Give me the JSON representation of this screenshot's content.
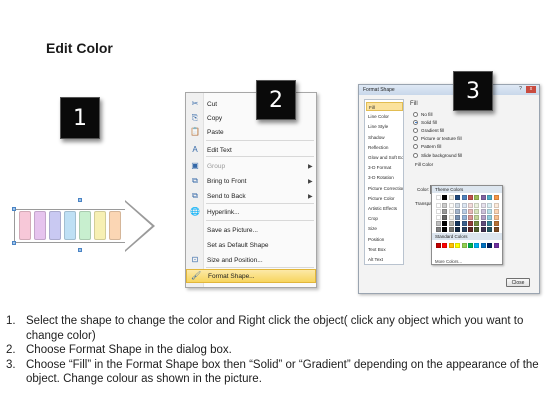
{
  "title": "Edit Color",
  "steps": [
    {
      "num": "1.",
      "text": "Select the shape to change the color and Right click the object( click any object which you want to change color)"
    },
    {
      "num": "2.",
      "text": "Choose Format Shape in the dialog box."
    },
    {
      "num": "3.",
      "text": "Choose “Fill” in the Format Shape box then “Solid” or “Gradient” depending on the appearance of the object. Change colour as shown in the picture."
    }
  ],
  "badges": [
    "1",
    "2",
    "3"
  ],
  "shape": {
    "segment_colors": [
      "#f7c8d8",
      "#e6c4ee",
      "#c9c9f2",
      "#bfe0f5",
      "#c8efcf",
      "#f7f0b4",
      "#fbd6b4"
    ]
  },
  "context_menu": {
    "items": [
      {
        "label": "Cut",
        "icon": "scissors-icon",
        "glyph": "✂"
      },
      {
        "label": "Copy",
        "icon": "copy-icon",
        "glyph": "⎘"
      },
      {
        "label": "Paste",
        "icon": "paste-icon",
        "glyph": "📋"
      },
      {
        "label": "Edit Text",
        "icon": "edit-text-icon",
        "glyph": "A"
      },
      {
        "label": "Group",
        "icon": "group-icon",
        "glyph": "▣",
        "disabled": true,
        "submenu": true
      },
      {
        "label": "Bring to Front",
        "icon": "bring-to-front-icon",
        "glyph": "⧉",
        "submenu": true
      },
      {
        "label": "Send to Back",
        "icon": "send-to-back-icon",
        "glyph": "⧉",
        "submenu": true
      },
      {
        "label": "Hyperlink...",
        "icon": "hyperlink-icon",
        "glyph": "🌐"
      },
      {
        "label": "Save as Picture...",
        "icon": "",
        "glyph": ""
      },
      {
        "label": "Set as Default Shape",
        "icon": "",
        "glyph": ""
      },
      {
        "label": "Size and Position...",
        "icon": "size-position-icon",
        "glyph": "⊡"
      },
      {
        "label": "Format Shape...",
        "icon": "format-shape-icon",
        "glyph": "🖌",
        "highlighted": true
      }
    ]
  },
  "dialog": {
    "title": "Format Shape",
    "help": "?",
    "close_x": "x",
    "nav": [
      "Fill",
      "Line Color",
      "Line Style",
      "Shadow",
      "Reflection",
      "Glow and Soft Edges",
      "3-D Format",
      "3-D Rotation",
      "Picture Corrections",
      "Picture Color",
      "Artistic Effects",
      "Crop",
      "Size",
      "Position",
      "Text Box",
      "Alt Text"
    ],
    "selected_nav": "Fill",
    "panel_heading": "Fill",
    "options": [
      "No fill",
      "Solid fill",
      "Gradient fill",
      "Picture or texture fill",
      "Pattern fill",
      "Slide background fill"
    ],
    "selected_option": "Solid fill",
    "fill_color_label": "Fill Color",
    "color_label": "Color:",
    "transparency_label": "Transpar",
    "palette": {
      "theme_label": "Theme Colors",
      "standard_label": "Standard Colors",
      "more_label": "More Colors...",
      "theme_top": [
        "#ffffff",
        "#000000",
        "#eeece1",
        "#1f497d",
        "#4f81bd",
        "#c0504d",
        "#9bbb59",
        "#8064a2",
        "#4bacc6",
        "#f79646"
      ],
      "standard": [
        "#c00000",
        "#ff0000",
        "#ffc000",
        "#ffff00",
        "#92d050",
        "#00b050",
        "#00b0f0",
        "#0070c0",
        "#002060",
        "#7030a0"
      ]
    },
    "close_label": "Close"
  }
}
